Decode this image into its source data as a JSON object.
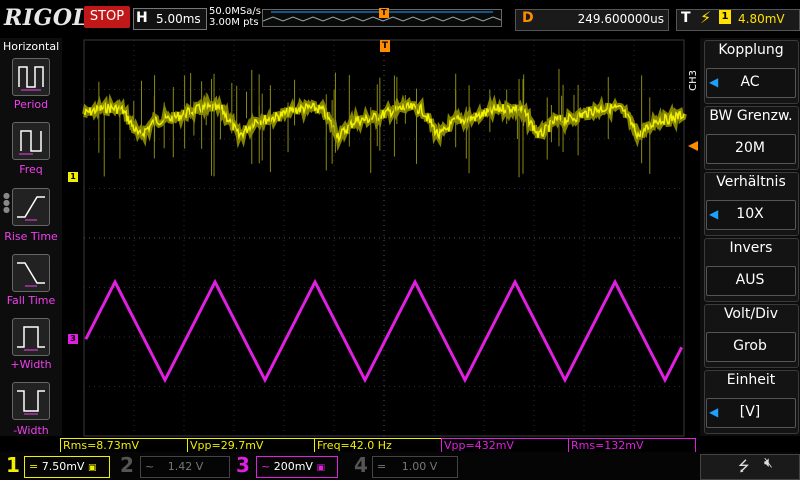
{
  "top": {
    "logo": "RIGOL",
    "run_state": "STOP",
    "timebase_letter": "H",
    "timebase": "5.00ms",
    "sample_rate": "50.0MSa/s",
    "memory_depth": "3.00M pts",
    "trigger_marker": "T",
    "delay_letter": "D",
    "delay": "249.600000us",
    "trigger_letter": "T",
    "trigger_source": "1",
    "trigger_level": "4.80mV",
    "trigger_slope_icon": "falling-edge-icon"
  },
  "left_panel": {
    "title": "Horizontal",
    "items": [
      {
        "label": "Period",
        "icon": "period-icon"
      },
      {
        "label": "Freq",
        "icon": "freq-icon"
      },
      {
        "label": "Rise Time",
        "icon": "rise-time-icon"
      },
      {
        "label": "Fall Time",
        "icon": "fall-time-icon"
      },
      {
        "label": "+Width",
        "icon": "pos-width-icon"
      },
      {
        "label": "-Width",
        "icon": "neg-width-icon"
      }
    ]
  },
  "right_panel": {
    "channel_label": "CH3",
    "settings": [
      {
        "title": "Kopplung",
        "value": "AC",
        "has_arrow": true
      },
      {
        "title": "BW Grenzw.",
        "value": "20M",
        "has_arrow": false
      },
      {
        "title": "Verhältnis",
        "value": "10X",
        "has_arrow": true
      },
      {
        "title": "Invers",
        "value": "AUS",
        "has_arrow": false
      },
      {
        "title": "Volt/Div",
        "value": "Grob",
        "has_arrow": false
      },
      {
        "title": "Einheit",
        "value": "[V]",
        "has_arrow": true
      }
    ]
  },
  "waveform": {
    "ch1_marker": "1",
    "ch3_marker": "3",
    "trigger_pos_marker": "T",
    "ch1_color": "#f0f000",
    "ch3_color": "#e020e0",
    "triangle_cycles": 6
  },
  "measurements": [
    {
      "label": "Rms=8.73mV",
      "color": "#f0f000"
    },
    {
      "label": "Vpp=29.7mV",
      "color": "#f0f000"
    },
    {
      "label": "Freq=42.0 Hz",
      "color": "#f0f000"
    },
    {
      "label": "Vpp=432mV",
      "color": "#e020e0"
    },
    {
      "label": "Rms=132mV",
      "color": "#e020e0"
    }
  ],
  "bottom": {
    "channels": [
      {
        "num": "1",
        "coupling": "=",
        "scale": "7.50mV",
        "color": "#f0f000",
        "active": true
      },
      {
        "num": "2",
        "coupling": "~",
        "scale": "1.42 V",
        "color": "#444444",
        "active": false
      },
      {
        "num": "3",
        "coupling": "~",
        "scale": "200mV",
        "color": "#e020e0",
        "active": true
      },
      {
        "num": "4",
        "coupling": "=",
        "scale": "1.00 V",
        "color": "#444444",
        "active": false
      }
    ],
    "usb_icon": "usb-icon",
    "sound_icon": "speaker-muted-icon"
  }
}
